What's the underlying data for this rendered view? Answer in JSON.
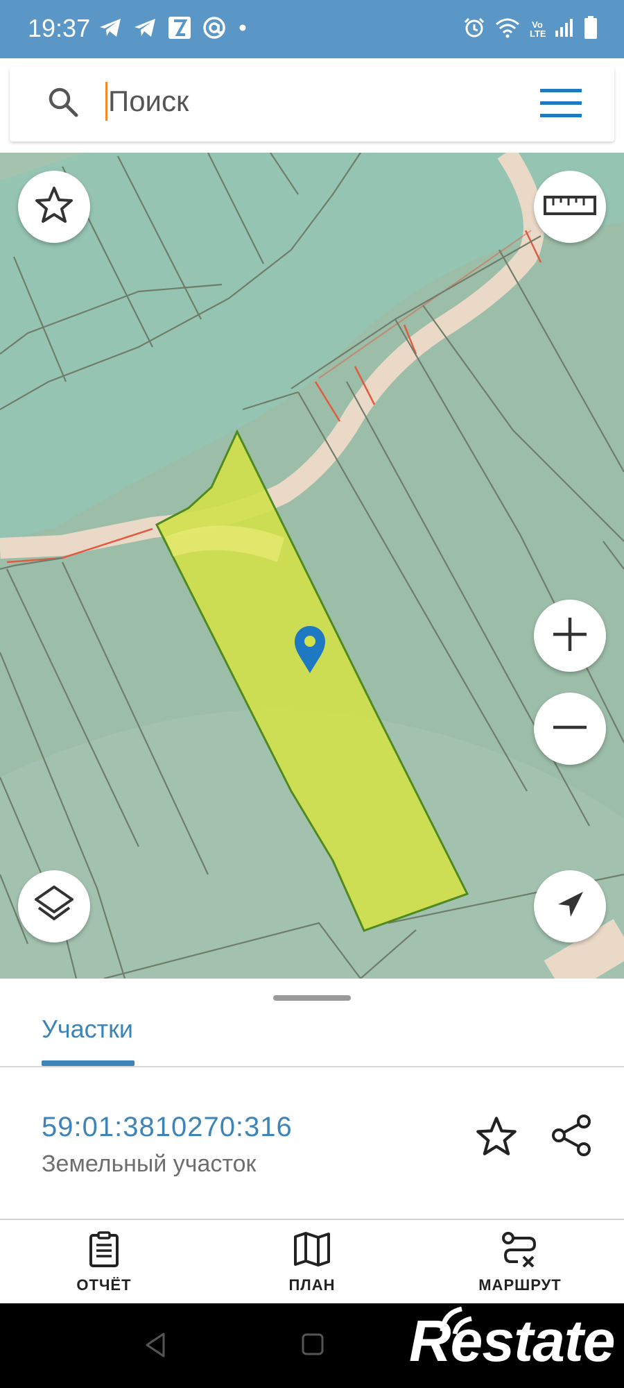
{
  "status_bar": {
    "time": "19:37",
    "left_icons": [
      "telegram-icon",
      "telegram-icon",
      "app-icon",
      "at-sign-icon",
      "dot-icon"
    ],
    "right_icons": [
      "alarm-icon",
      "wifi-icon",
      "volte-icon",
      "signal-icon",
      "battery-icon"
    ],
    "volte_label": "Vo LTE",
    "background": "#5a97c7"
  },
  "search": {
    "placeholder": "Поиск",
    "value": ""
  },
  "map": {
    "land_color": "#9cbda8",
    "river_color": "#95c4b3",
    "road_color": "#ebd9c8",
    "selected_parcel_color": "#d2e04a",
    "marker_color": "#1e78c2",
    "buttons": [
      "favorite-star-button",
      "ruler-button",
      "layers-button",
      "zoom-in-button",
      "zoom-out-button",
      "location-button"
    ]
  },
  "bottom_sheet": {
    "tab_label": "Участки",
    "parcel": {
      "number": "59:01:3810270:316",
      "type": "Земельный участок"
    }
  },
  "bottom_nav": {
    "items": [
      {
        "label": "ОТЧЁТ",
        "icon": "report-icon"
      },
      {
        "label": "ПЛАН",
        "icon": "map-icon"
      },
      {
        "label": "МАРШРУТ",
        "icon": "route-icon"
      }
    ]
  },
  "watermark": {
    "text": "Restate"
  },
  "accent": "#3d84b8"
}
